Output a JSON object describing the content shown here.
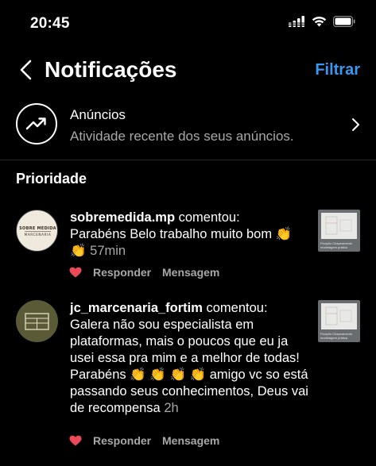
{
  "status_bar": {
    "time": "20:45",
    "icons": [
      "signal-icon",
      "wifi-icon",
      "battery-icon"
    ]
  },
  "header": {
    "title": "Notificações",
    "filter_label": "Filtrar",
    "back_icon": "chevron-left-icon"
  },
  "ads": {
    "title": "Anúncios",
    "subtitle": "Atividade recente dos seus anúncios.",
    "icon": "trending-up-icon"
  },
  "section": {
    "title": "Prioridade"
  },
  "notifications": [
    {
      "username": "sobremedida.mp",
      "action": " comentou:",
      "comment": "Parabéns Belo trabalho muito bom 👏 👏",
      "time": "57min",
      "avatar_text": "SOBRE MEDIDA MARCENARIA",
      "thumb_caption": "Fixação Chapeamento modelagem prática",
      "reply_label": "Responder",
      "message_label": "Mensagem"
    },
    {
      "username": "jc_marcenaria_fortim",
      "action": " comentou:",
      "comment": "Galera não sou especialista em plataformas, mais o poucos que eu ja usei essa pra mim e a melhor de todas!  Parabéns 👏 👏 👏 👏  amigo vc so está passando seus conhecimentos, Deus vai de recompensa",
      "time": "2h",
      "thumb_caption": "Fixação Chapeamento modelagem prática",
      "reply_label": "Responder",
      "message_label": "Mensagem"
    }
  ],
  "colors": {
    "accent": "#3897f0",
    "like": "#ed4956",
    "secondary_text": "#a8a8a8",
    "background": "#000000"
  }
}
